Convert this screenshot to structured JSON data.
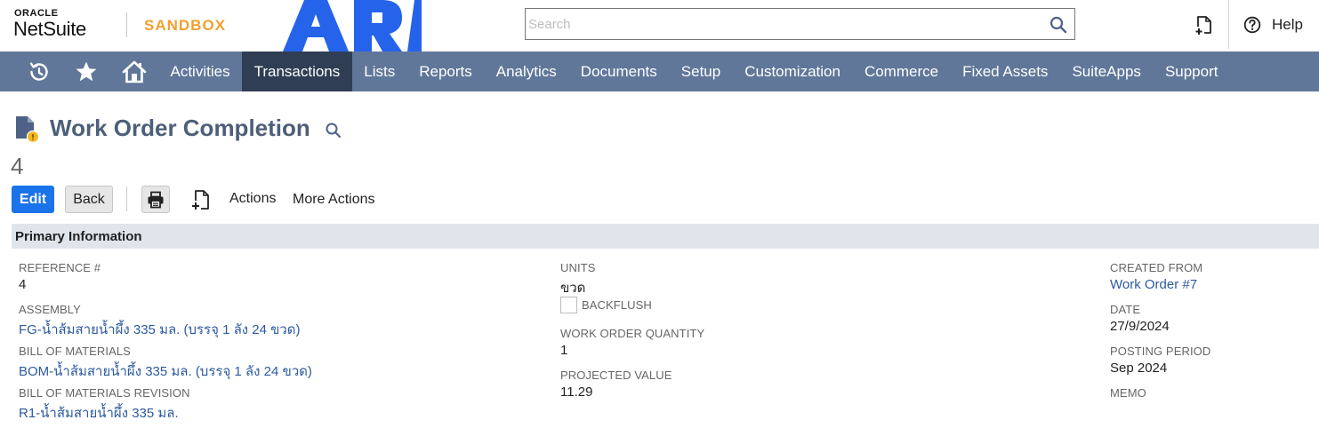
{
  "header": {
    "oracle": "ORACLE",
    "netsuite": "NetSuite",
    "sandbox": "SANDBOX",
    "search_placeholder": "Search",
    "help": "Help"
  },
  "nav": {
    "items": [
      "Activities",
      "Transactions",
      "Lists",
      "Reports",
      "Analytics",
      "Documents",
      "Setup",
      "Customization",
      "Commerce",
      "Fixed Assets",
      "SuiteApps",
      "Support"
    ],
    "active": "Transactions"
  },
  "page": {
    "title": "Work Order Completion",
    "record_number": "4"
  },
  "toolbar": {
    "edit": "Edit",
    "back": "Back",
    "actions": "Actions",
    "more_actions": "More Actions"
  },
  "section": {
    "title": "Primary Information"
  },
  "fields": {
    "reference": {
      "label": "REFERENCE #",
      "value": "4"
    },
    "assembly": {
      "label": "ASSEMBLY",
      "value": "FG-น้ำส้มสายน้ำผึ้ง 335 มล. (บรรจุ 1 ลัง 24 ขวด)"
    },
    "bom": {
      "label": "BILL OF MATERIALS",
      "value": "BOM-น้ำส้มสายน้ำผึ้ง 335 มล. (บรรจุ 1 ลัง 24 ขวด)"
    },
    "bom_revision": {
      "label": "BILL OF MATERIALS REVISION",
      "value": "R1-น้ำส้มสายน้ำผึ้ง 335 มล."
    },
    "units": {
      "label": "UNITS",
      "value": "ขวด"
    },
    "backflush": {
      "label": "BACKFLUSH",
      "checked": false
    },
    "wo_quantity": {
      "label": "WORK ORDER QUANTITY",
      "value": "1"
    },
    "projected_value": {
      "label": "PROJECTED VALUE",
      "value": "11.29"
    },
    "created_from": {
      "label": "CREATED FROM",
      "value": "Work Order #7"
    },
    "date": {
      "label": "DATE",
      "value": "27/9/2024"
    },
    "posting_period": {
      "label": "POSTING PERIOD",
      "value": "Sep 2024"
    },
    "memo": {
      "label": "MEMO"
    }
  },
  "colors": {
    "nav_bg": "#607799",
    "nav_active": "#2f3e54",
    "accent": "#1a73e8",
    "sandbox": "#f0a030",
    "ari_logo": "#2563eb",
    "link": "#2c5aa0",
    "title": "#4d5f79"
  },
  "icons": {
    "recent": "history-icon",
    "favorites": "star-icon",
    "home": "home-icon",
    "search": "search-icon",
    "new_record": "add-record-icon",
    "help": "help-icon",
    "print": "print-icon",
    "document": "document-icon"
  }
}
